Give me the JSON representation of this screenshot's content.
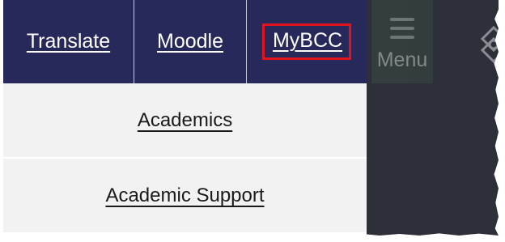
{
  "top_nav": {
    "translate_label": "Translate",
    "moodle_label": "Moodle",
    "mybcc_label": "MyBCC"
  },
  "menu_button": {
    "label": "Menu"
  },
  "main_menu": {
    "items": [
      {
        "label": "Academics"
      },
      {
        "label": "Academic Support"
      }
    ]
  },
  "colors": {
    "nav_background": "#27295a",
    "highlight_border": "#e0141e",
    "side_panel": "#2d3039",
    "menu_row": "#f2f2f2"
  },
  "icons": {
    "menu": "hamburger-icon",
    "logo": "knot-logo-icon"
  }
}
